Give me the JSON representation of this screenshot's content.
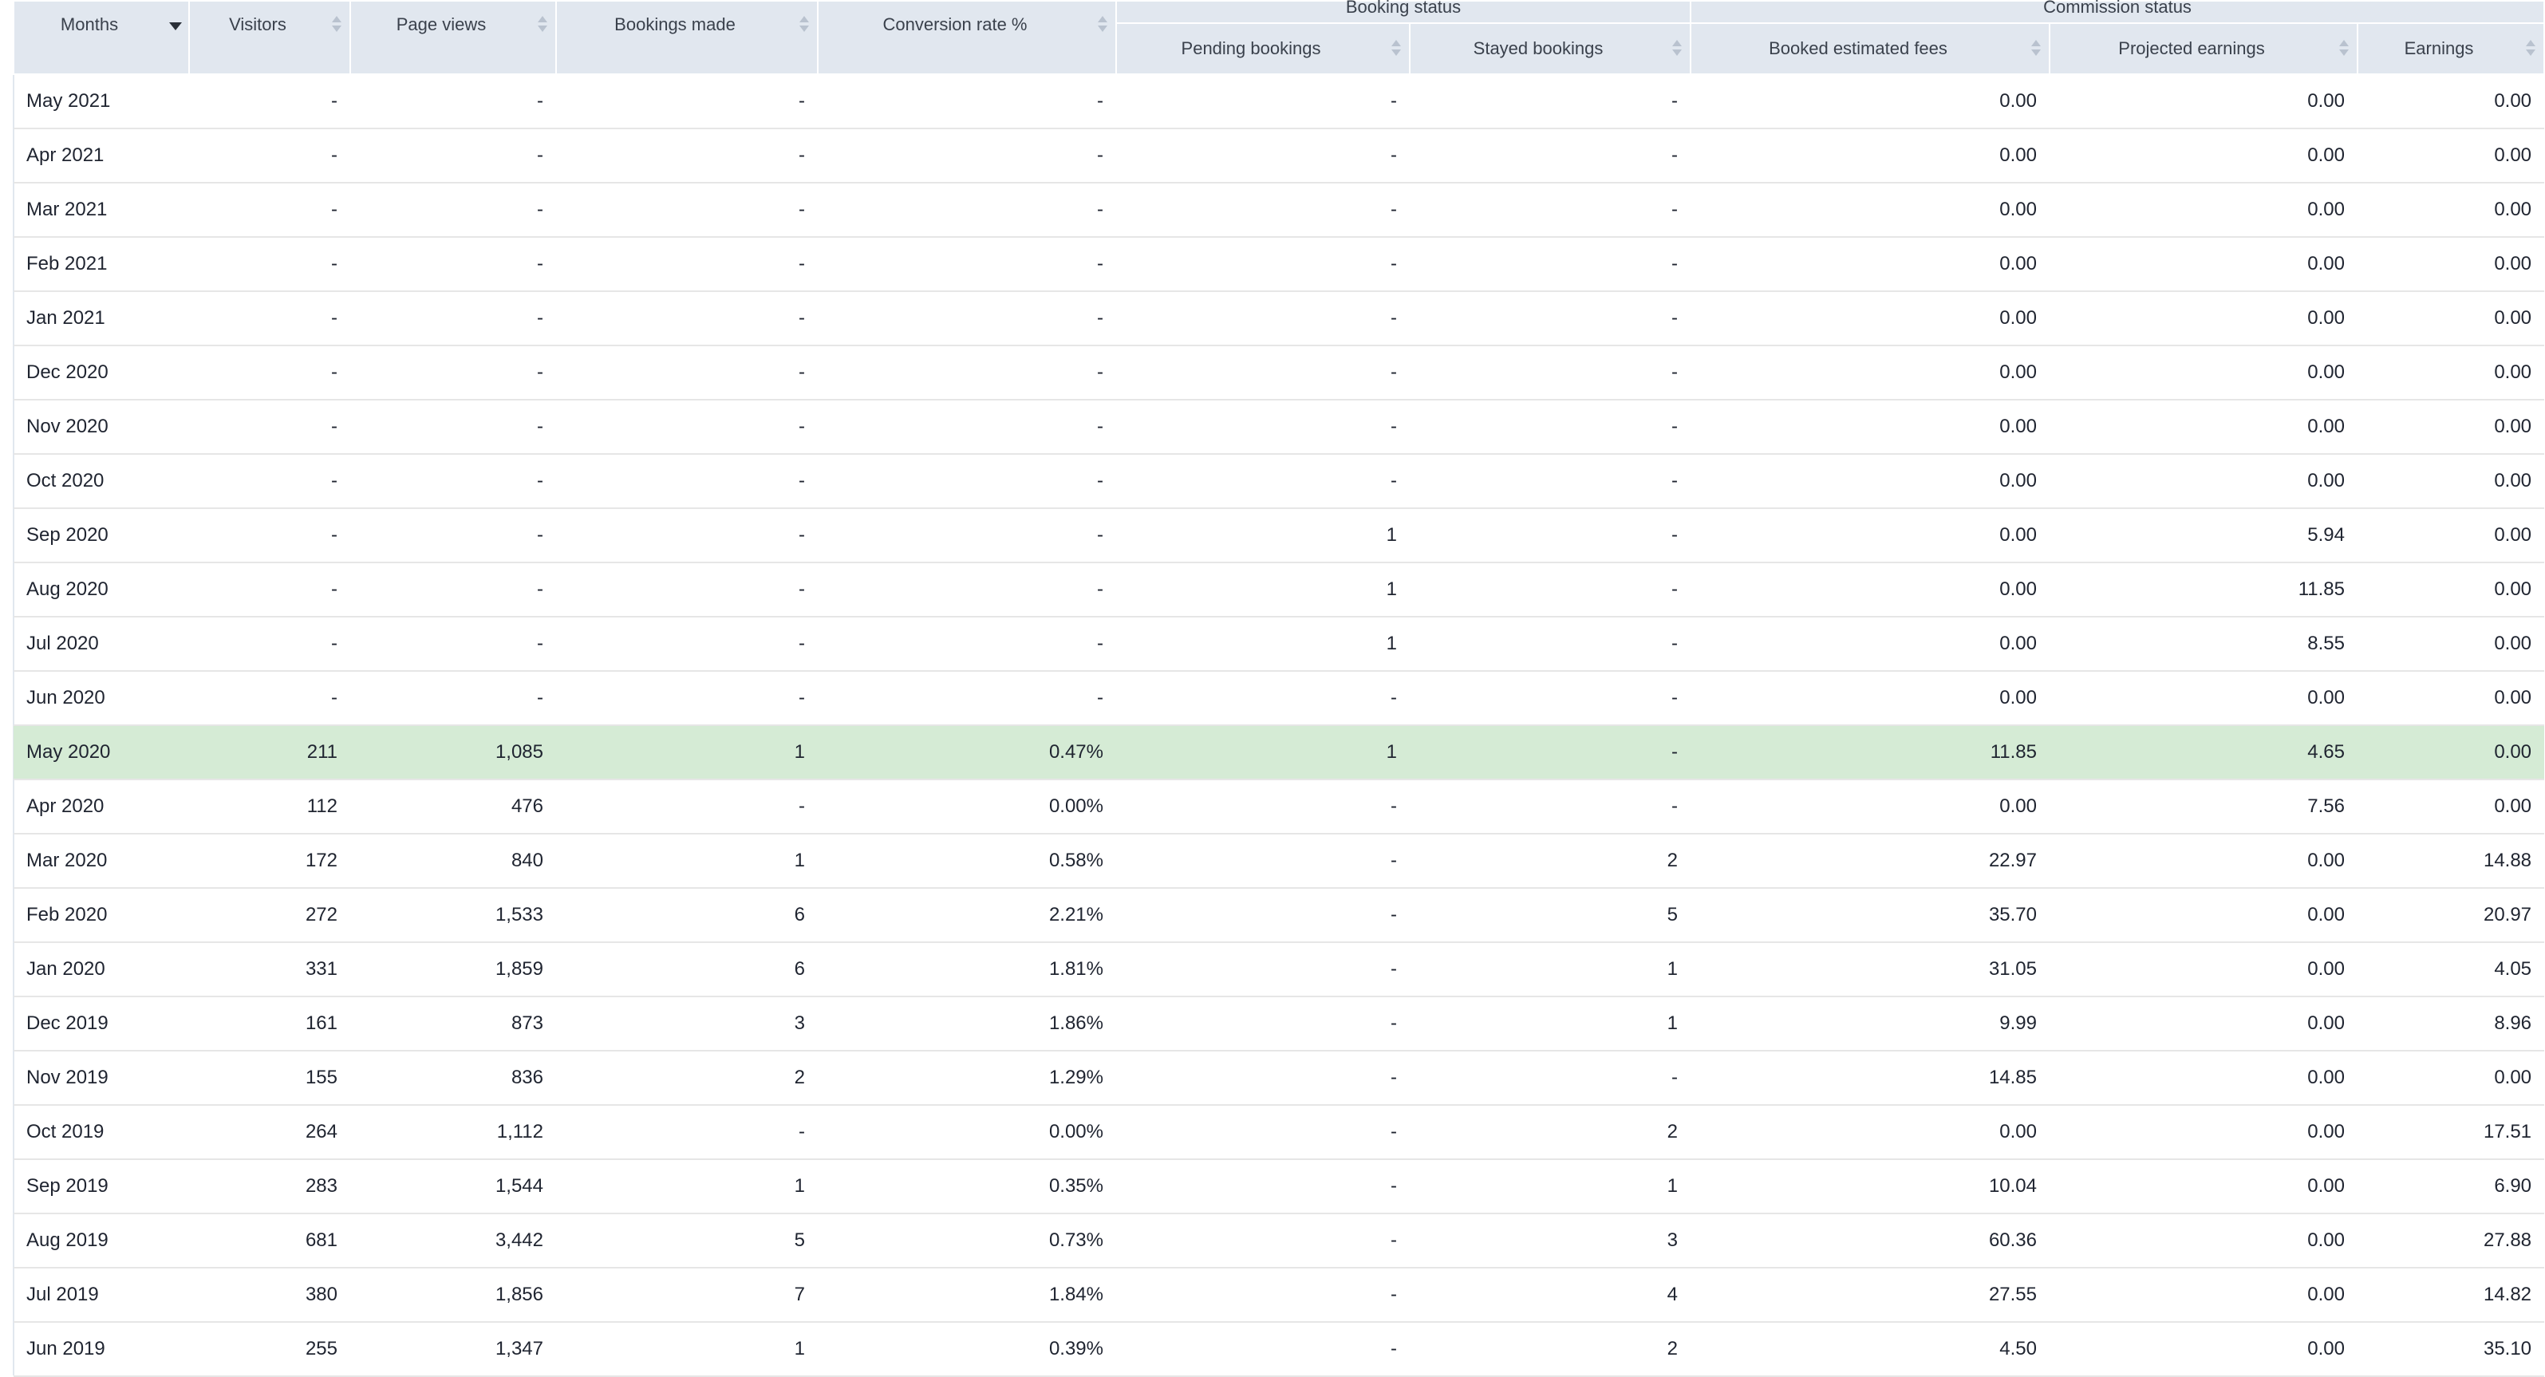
{
  "table": {
    "group_headers": {
      "booking_status": "Booking status",
      "commission_status": "Commission status"
    },
    "columns": {
      "months": "Months",
      "visitors": "Visitors",
      "page_views": "Page views",
      "bookings_made": "Bookings made",
      "conversion_rate": "Conversion rate %",
      "pending_bookings": "Pending bookings",
      "stayed_bookings": "Stayed bookings",
      "booked_estimated_fees": "Booked estimated fees",
      "projected_earnings": "Projected earnings",
      "earnings": "Earnings"
    },
    "sorted_column": "months",
    "sort_direction": "descending",
    "highlight_color": "#d5ebd5",
    "rows": [
      [
        "May 2021",
        "-",
        "-",
        "-",
        "-",
        "-",
        "-",
        "0.00",
        "0.00",
        "0.00"
      ],
      [
        "Apr 2021",
        "-",
        "-",
        "-",
        "-",
        "-",
        "-",
        "0.00",
        "0.00",
        "0.00"
      ],
      [
        "Mar 2021",
        "-",
        "-",
        "-",
        "-",
        "-",
        "-",
        "0.00",
        "0.00",
        "0.00"
      ],
      [
        "Feb 2021",
        "-",
        "-",
        "-",
        "-",
        "-",
        "-",
        "0.00",
        "0.00",
        "0.00"
      ],
      [
        "Jan 2021",
        "-",
        "-",
        "-",
        "-",
        "-",
        "-",
        "0.00",
        "0.00",
        "0.00"
      ],
      [
        "Dec 2020",
        "-",
        "-",
        "-",
        "-",
        "-",
        "-",
        "0.00",
        "0.00",
        "0.00"
      ],
      [
        "Nov 2020",
        "-",
        "-",
        "-",
        "-",
        "-",
        "-",
        "0.00",
        "0.00",
        "0.00"
      ],
      [
        "Oct 2020",
        "-",
        "-",
        "-",
        "-",
        "-",
        "-",
        "0.00",
        "0.00",
        "0.00"
      ],
      [
        "Sep 2020",
        "-",
        "-",
        "-",
        "-",
        "1",
        "-",
        "0.00",
        "5.94",
        "0.00"
      ],
      [
        "Aug 2020",
        "-",
        "-",
        "-",
        "-",
        "1",
        "-",
        "0.00",
        "11.85",
        "0.00"
      ],
      [
        "Jul 2020",
        "-",
        "-",
        "-",
        "-",
        "1",
        "-",
        "0.00",
        "8.55",
        "0.00"
      ],
      [
        "Jun 2020",
        "-",
        "-",
        "-",
        "-",
        "-",
        "-",
        "0.00",
        "0.00",
        "0.00"
      ],
      [
        "May 2020",
        "211",
        "1,085",
        "1",
        "0.47%",
        "1",
        "-",
        "11.85",
        "4.65",
        "0.00"
      ],
      [
        "Apr 2020",
        "112",
        "476",
        "-",
        "0.00%",
        "-",
        "-",
        "0.00",
        "7.56",
        "0.00"
      ],
      [
        "Mar 2020",
        "172",
        "840",
        "1",
        "0.58%",
        "-",
        "2",
        "22.97",
        "0.00",
        "14.88"
      ],
      [
        "Feb 2020",
        "272",
        "1,533",
        "6",
        "2.21%",
        "-",
        "5",
        "35.70",
        "0.00",
        "20.97"
      ],
      [
        "Jan 2020",
        "331",
        "1,859",
        "6",
        "1.81%",
        "-",
        "1",
        "31.05",
        "0.00",
        "4.05"
      ],
      [
        "Dec 2019",
        "161",
        "873",
        "3",
        "1.86%",
        "-",
        "1",
        "9.99",
        "0.00",
        "8.96"
      ],
      [
        "Nov 2019",
        "155",
        "836",
        "2",
        "1.29%",
        "-",
        "-",
        "14.85",
        "0.00",
        "0.00"
      ],
      [
        "Oct 2019",
        "264",
        "1,112",
        "-",
        "0.00%",
        "-",
        "2",
        "0.00",
        "0.00",
        "17.51"
      ],
      [
        "Sep 2019",
        "283",
        "1,544",
        "1",
        "0.35%",
        "-",
        "1",
        "10.04",
        "0.00",
        "6.90"
      ],
      [
        "Aug 2019",
        "681",
        "3,442",
        "5",
        "0.73%",
        "-",
        "3",
        "60.36",
        "0.00",
        "27.88"
      ],
      [
        "Jul 2019",
        "380",
        "1,856",
        "7",
        "1.84%",
        "-",
        "4",
        "27.55",
        "0.00",
        "14.82"
      ],
      [
        "Jun 2019",
        "255",
        "1,347",
        "1",
        "0.39%",
        "-",
        "2",
        "4.50",
        "0.00",
        "35.10"
      ]
    ],
    "highlighted_row": "May 2020"
  }
}
